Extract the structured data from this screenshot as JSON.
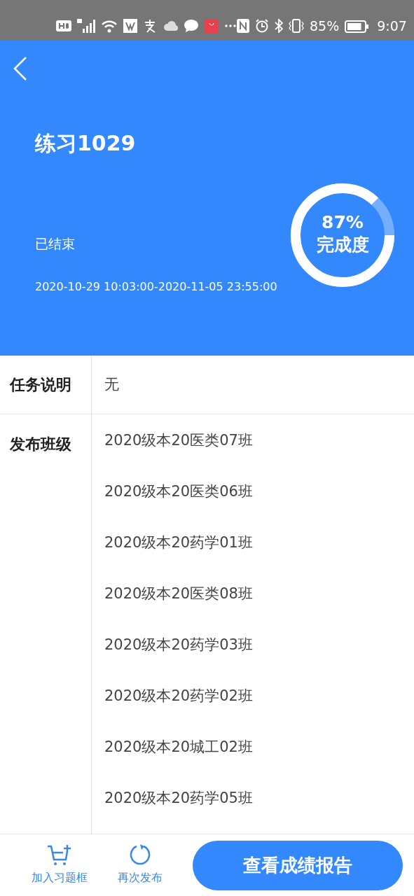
{
  "status_bar": {
    "battery": "85%",
    "time": "9:07"
  },
  "header": {
    "title": "练习1029",
    "status": "已结束",
    "period": "2020-10-29 10:03:00-2020-11-05 23:55:00",
    "progress": {
      "percent": "87%",
      "label": "完成度"
    }
  },
  "details": [
    {
      "label": "任务说明",
      "values": [
        "无"
      ]
    },
    {
      "label": "发布班级",
      "values": [
        "2020级本20医类07班",
        "2020级本20医类06班",
        "2020级本20药学01班",
        "2020级本20医类08班",
        "2020级本20药学03班",
        "2020级本20药学02班",
        "2020级本20城工02班",
        "2020级本20药学05班"
      ]
    }
  ],
  "bottom_bar": {
    "actions": [
      {
        "kind": "cart",
        "label": "加入习题框"
      },
      {
        "kind": "refresh",
        "label": "再次发布"
      }
    ],
    "primary_button": "查看成绩报告"
  }
}
